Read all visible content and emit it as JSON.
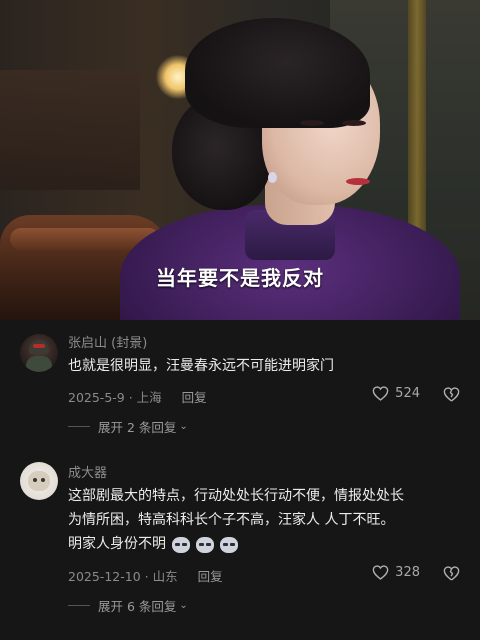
{
  "video": {
    "subtitle": "当年要不是我反对"
  },
  "comments": [
    {
      "username": "张启山 (封景)",
      "text": "也就是很明显，汪曼春永远不可能进明家门",
      "date_location": "2025-5-9 · 上海",
      "reply_label": "回复",
      "likes": "524",
      "expand_label": "展开 2 条回复",
      "avatar_icon": "soldier-avatar"
    },
    {
      "username": "成大器",
      "text_line1": "这部剧最大的特点，行动处处长行动不便，情报处处长",
      "text_line2": "为情所困，特高科科长个子不高，汪家人 人丁不旺。",
      "text_line3": "明家人身份不明",
      "emojis": [
        "grin-emoji",
        "grin-emoji",
        "grin-emoji"
      ],
      "date_location": "2025-12-10 · 山东",
      "reply_label": "回复",
      "likes": "328",
      "expand_label": "展开 6 条回复",
      "avatar_icon": "cat-avatar"
    }
  ],
  "colors": {
    "background": "#161616",
    "username": "#8d8d8d",
    "text": "#ececec",
    "meta": "#8a8a8a"
  }
}
